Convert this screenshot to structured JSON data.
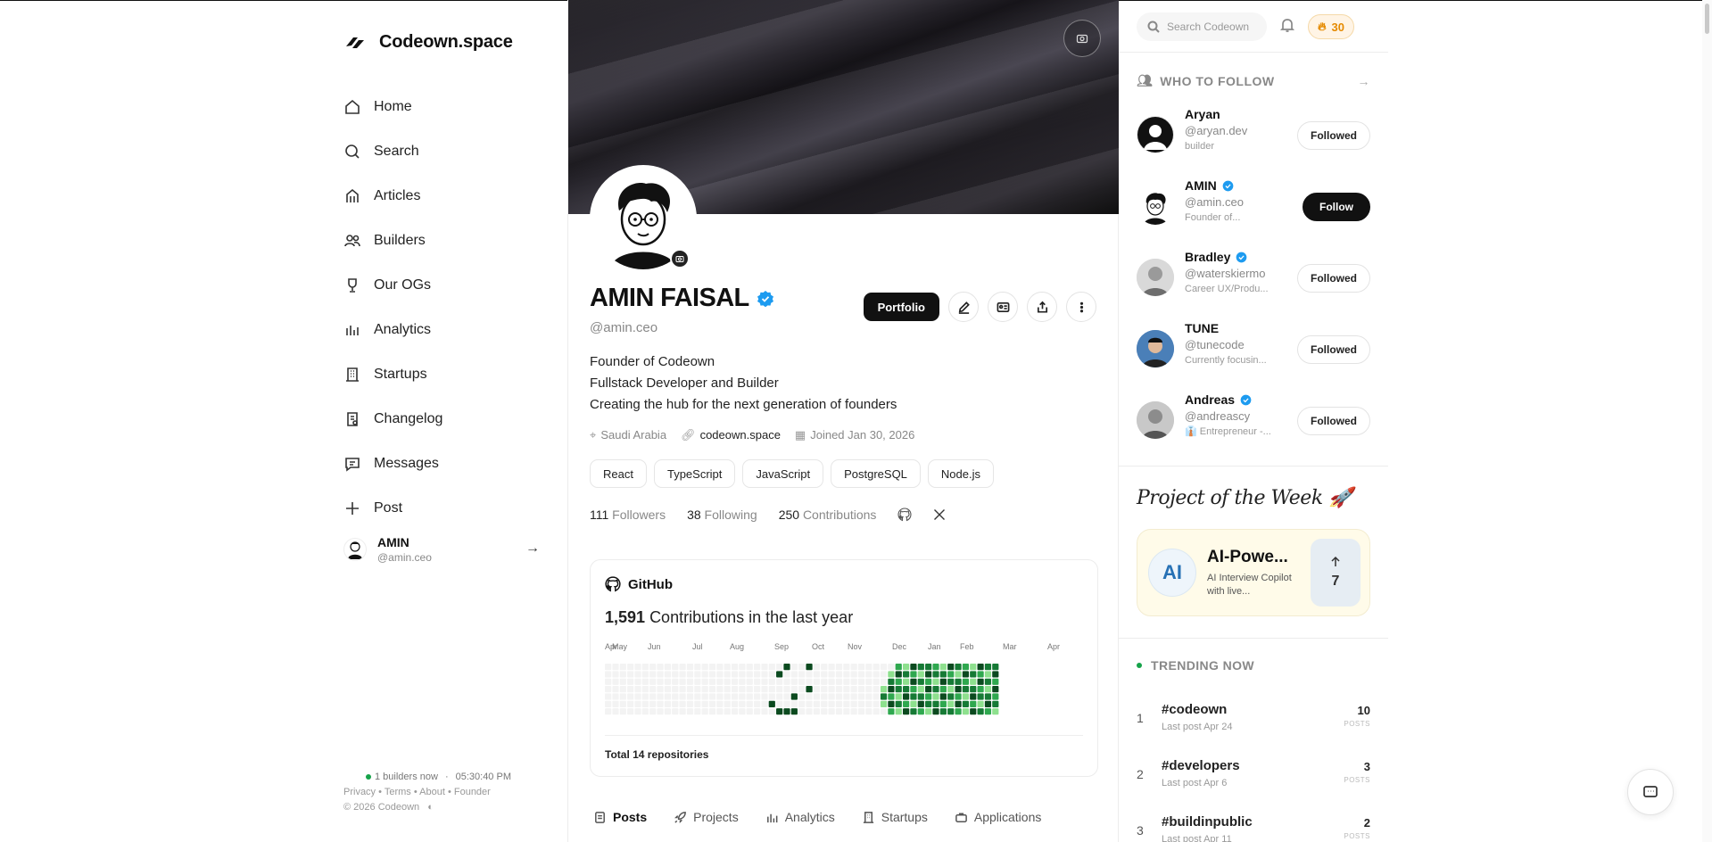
{
  "brand": {
    "name": "Codeown.space"
  },
  "nav": [
    {
      "label": "Home",
      "icon": "home-icon"
    },
    {
      "label": "Search",
      "icon": "search-icon"
    },
    {
      "label": "Articles",
      "icon": "articles-icon"
    },
    {
      "label": "Builders",
      "icon": "builders-icon"
    },
    {
      "label": "Our OGs",
      "icon": "trophy-icon"
    },
    {
      "label": "Analytics",
      "icon": "analytics-icon"
    },
    {
      "label": "Startups",
      "icon": "building-icon"
    },
    {
      "label": "Changelog",
      "icon": "changelog-icon"
    },
    {
      "label": "Messages",
      "icon": "message-icon"
    },
    {
      "label": "Post",
      "icon": "plus-icon"
    }
  ],
  "sidebar_profile": {
    "name": "AMIN",
    "handle": "@amin.ceo"
  },
  "footer": {
    "online": "1 builders now",
    "time": "05:30:40 PM",
    "links": [
      "Privacy",
      "Terms",
      "About",
      "Founder"
    ],
    "copyright": "© 2026 Codeown"
  },
  "profile": {
    "name": "AMIN FAISAL",
    "handle": "@amin.ceo",
    "portfolio_label": "Portfolio",
    "bio": [
      "Founder of Codeown",
      "Fullstack Developer and Builder",
      "Creating the hub for the next generation of founders"
    ],
    "location": "Saudi Arabia",
    "website": "codeown.space",
    "joined": "Joined Jan 30, 2026",
    "tags": [
      "React",
      "TypeScript",
      "JavaScript",
      "PostgreSQL",
      "Node.js"
    ],
    "followers_count": "111",
    "followers_label": "Followers",
    "following_count": "38",
    "following_label": "Following",
    "contributions_count": "250",
    "contributions_label": "Contributions"
  },
  "github": {
    "title": "GitHub",
    "contributions": "1,591",
    "contributions_label": "Contributions in the last year",
    "months": [
      "Apr",
      "May",
      "Jun",
      "Jul",
      "Aug",
      "Sep",
      "Oct",
      "Nov",
      "Dec",
      "Jan",
      "Feb",
      "Mar",
      "Apr"
    ],
    "total_repos": "Total 14 repositories",
    "colors": {
      "empty": "#f3f3f3",
      "l1": "#8ee08e",
      "l2": "#2fa84f",
      "l3": "#167a35",
      "l4": "#0b4a1f"
    }
  },
  "tabs": [
    {
      "label": "Posts",
      "active": true
    },
    {
      "label": "Projects",
      "active": false
    },
    {
      "label": "Analytics",
      "active": false
    },
    {
      "label": "Startups",
      "active": false
    },
    {
      "label": "Applications",
      "active": false
    }
  ],
  "topbar": {
    "search_placeholder": "Search Codeown",
    "streak": "30"
  },
  "who_to_follow": {
    "title": "WHO TO FOLLOW",
    "items": [
      {
        "name": "Aryan",
        "handle": "@aryan.dev",
        "bio": "builder",
        "verified": false,
        "button": "Followed",
        "primary": false
      },
      {
        "name": "AMIN",
        "handle": "@amin.ceo",
        "bio": "Founder of...",
        "verified": true,
        "button": "Follow",
        "primary": true
      },
      {
        "name": "Bradley",
        "handle": "@waterskiermo",
        "bio": "Career UX/Produ...",
        "verified": true,
        "button": "Followed",
        "primary": false
      },
      {
        "name": "TUNE",
        "handle": "@tunecode",
        "bio": "Currently focusin...",
        "verified": false,
        "button": "Followed",
        "primary": false
      },
      {
        "name": "Andreas",
        "handle": "@andreascy",
        "bio": "👔 Entrepreneur -...",
        "verified": true,
        "button": "Followed",
        "primary": false
      }
    ]
  },
  "project_of_week": {
    "title": "Project of the Week 🚀",
    "logo": "AI",
    "name": "AI-Powe...",
    "desc": "AI Interview Copilot with live...",
    "votes": "7"
  },
  "trending": {
    "title": "TRENDING NOW",
    "items": [
      {
        "rank": "1",
        "tag": "#codeown",
        "last": "Last post Apr 24",
        "count": "10",
        "unit": "POSTS"
      },
      {
        "rank": "2",
        "tag": "#developers",
        "last": "Last post Apr 6",
        "count": "3",
        "unit": "POSTS"
      },
      {
        "rank": "3",
        "tag": "#buildinpublic",
        "last": "Last post Apr 11",
        "count": "2",
        "unit": "POSTS"
      }
    ]
  }
}
